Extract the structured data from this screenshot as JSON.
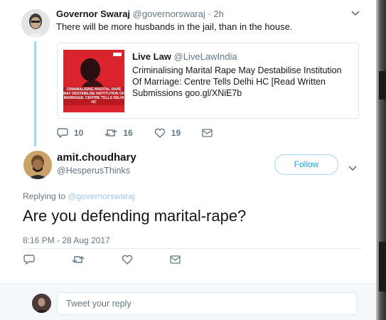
{
  "parent_tweet": {
    "name": "Governor Swaraj",
    "handle": "@governorswaraj",
    "separator": "·",
    "time": "2h",
    "text": "There will be more husbands in the jail, than in the house.",
    "quote": {
      "name": "Live Law",
      "handle": "@LiveLawIndia",
      "text": "Criminalising Marital Rape May Destabilise Institution Of Marriage: Centre Tells Delhi HC [Read Written Submissions goo.gl/XNiE7b",
      "thumb_caption": "CRIMINALISING MARITAL RAPE MAY DESTABILISE INSTITUTION OF MARRIAGE: CENTRE TELLS DELHI HC"
    },
    "actions": {
      "reply_count": "10",
      "retweet_count": "16",
      "like_count": "19"
    }
  },
  "main_tweet": {
    "name": "amit.choudhary",
    "handle": "@HesperusThinks",
    "follow_label": "Follow",
    "replying_prefix": "Replying to ",
    "replying_handle": "@governorswaraj",
    "text": "Are you defending marital-rape?",
    "timestamp": "8:16 PM - 28 Aug 2017"
  },
  "reply_bar": {
    "placeholder": "Tweet your reply"
  },
  "colors": {
    "link": "#1da1f2",
    "thread_line": "#a8d5f2",
    "muted": "#657786"
  }
}
